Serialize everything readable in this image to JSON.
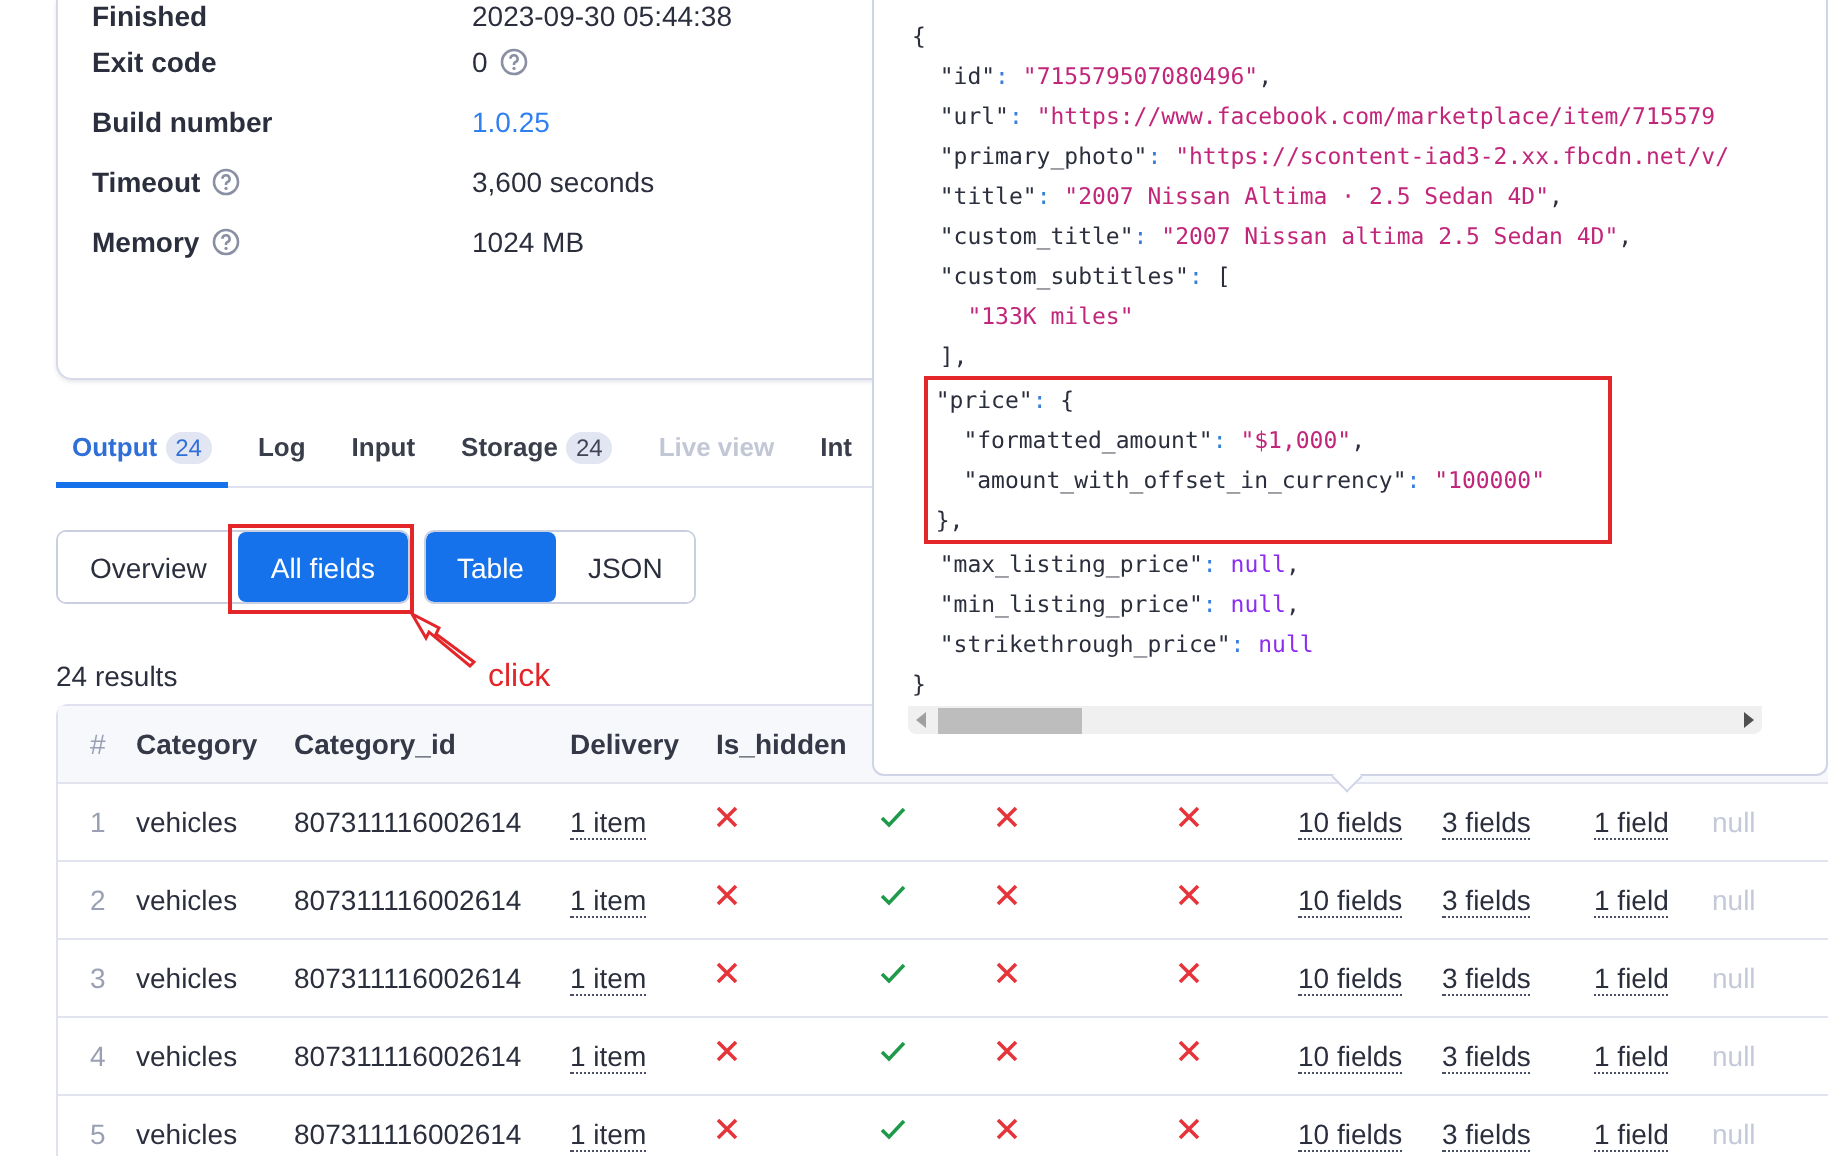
{
  "details": [
    {
      "label": "Finished",
      "value": "2023-09-30 05:44:38",
      "kind": "text",
      "label_help": false,
      "value_help": false
    },
    {
      "label": "Exit code",
      "value": "0",
      "kind": "text",
      "label_help": false,
      "value_help": true
    },
    {
      "label": "Build number",
      "value": "1.0.25",
      "kind": "link",
      "label_help": false,
      "value_help": false
    },
    {
      "label": "Timeout",
      "value": "3,600 seconds",
      "kind": "text",
      "label_help": true,
      "value_help": false
    },
    {
      "label": "Memory",
      "value": "1024 MB",
      "kind": "text",
      "label_help": true,
      "value_help": false
    }
  ],
  "tabs": [
    {
      "label": "Output",
      "badge": "24",
      "selected": true,
      "disabled": false
    },
    {
      "label": "Log",
      "selected": false,
      "disabled": false
    },
    {
      "label": "Input",
      "selected": false,
      "disabled": false
    },
    {
      "label": "Storage",
      "badge": "24",
      "selected": false,
      "disabled": false
    },
    {
      "label": "Live view",
      "selected": false,
      "disabled": true
    },
    {
      "label": "Int",
      "selected": false,
      "disabled": false
    }
  ],
  "view_modes": [
    {
      "label": "Overview",
      "selected": false
    },
    {
      "label": "All fields",
      "selected": true
    }
  ],
  "formats": [
    {
      "label": "Table",
      "selected": true
    },
    {
      "label": "JSON",
      "selected": false
    }
  ],
  "annotation": {
    "text": "click"
  },
  "results": "24 results",
  "table": {
    "columns": [
      "#",
      "Category",
      "Category_id",
      "Delivery",
      "Is_hidden"
    ],
    "rows": [
      {
        "cells": [
          {
            "kind": "index",
            "text": "1"
          },
          {
            "kind": "text",
            "text": "vehicles"
          },
          {
            "kind": "text",
            "text": "807311116002614"
          },
          {
            "kind": "link",
            "text": "1 item"
          },
          {
            "kind": "bool",
            "value": false
          },
          {
            "kind": "bool",
            "value": true
          },
          {
            "kind": "bool",
            "value": false
          },
          {
            "kind": "bool",
            "value": false
          },
          {
            "kind": "link",
            "text": "10 fields"
          },
          {
            "kind": "link",
            "text": "3 fields"
          },
          {
            "kind": "link",
            "text": "1 field"
          },
          {
            "kind": "null",
            "text": "null"
          }
        ]
      },
      {
        "cells": [
          {
            "kind": "index",
            "text": "2"
          },
          {
            "kind": "text",
            "text": "vehicles"
          },
          {
            "kind": "text",
            "text": "807311116002614"
          },
          {
            "kind": "link",
            "text": "1 item"
          },
          {
            "kind": "bool",
            "value": false
          },
          {
            "kind": "bool",
            "value": true
          },
          {
            "kind": "bool",
            "value": false
          },
          {
            "kind": "bool",
            "value": false
          },
          {
            "kind": "link",
            "text": "10 fields"
          },
          {
            "kind": "link",
            "text": "3 fields"
          },
          {
            "kind": "link",
            "text": "1 field"
          },
          {
            "kind": "null",
            "text": "null"
          }
        ]
      },
      {
        "cells": [
          {
            "kind": "index",
            "text": "3"
          },
          {
            "kind": "text",
            "text": "vehicles"
          },
          {
            "kind": "text",
            "text": "807311116002614"
          },
          {
            "kind": "link",
            "text": "1 item"
          },
          {
            "kind": "bool",
            "value": false
          },
          {
            "kind": "bool",
            "value": true
          },
          {
            "kind": "bool",
            "value": false
          },
          {
            "kind": "bool",
            "value": false
          },
          {
            "kind": "link",
            "text": "10 fields"
          },
          {
            "kind": "link",
            "text": "3 fields"
          },
          {
            "kind": "link",
            "text": "1 field"
          },
          {
            "kind": "null",
            "text": "null"
          }
        ]
      },
      {
        "cells": [
          {
            "kind": "index",
            "text": "4"
          },
          {
            "kind": "text",
            "text": "vehicles"
          },
          {
            "kind": "text",
            "text": "807311116002614"
          },
          {
            "kind": "link",
            "text": "1 item"
          },
          {
            "kind": "bool",
            "value": false
          },
          {
            "kind": "bool",
            "value": true
          },
          {
            "kind": "bool",
            "value": false
          },
          {
            "kind": "bool",
            "value": false
          },
          {
            "kind": "link",
            "text": "10 fields"
          },
          {
            "kind": "link",
            "text": "3 fields"
          },
          {
            "kind": "link",
            "text": "1 field"
          },
          {
            "kind": "null",
            "text": "null"
          }
        ]
      },
      {
        "cells": [
          {
            "kind": "index",
            "text": "5"
          },
          {
            "kind": "text",
            "text": "vehicles"
          },
          {
            "kind": "text",
            "text": "807311116002614"
          },
          {
            "kind": "link",
            "text": "1 item"
          },
          {
            "kind": "bool",
            "value": false
          },
          {
            "kind": "bool",
            "value": true
          },
          {
            "kind": "bool",
            "value": false
          },
          {
            "kind": "bool",
            "value": false
          },
          {
            "kind": "link",
            "text": "10 fields"
          },
          {
            "kind": "link",
            "text": "3 fields"
          },
          {
            "kind": "link",
            "text": "1 field"
          },
          {
            "kind": "null",
            "text": "null"
          }
        ]
      }
    ]
  },
  "popover": {
    "blocks": [
      {
        "highlighted": false,
        "lines": [
          {
            "tokens": [
              {
                "kind": "punct",
                "text": "{"
              }
            ]
          },
          {
            "tokens": [
              {
                "kind": "key",
                "text": "  \"id\""
              },
              {
                "kind": "colon",
                "text": ": "
              },
              {
                "kind": "string",
                "text": "\"715579507080496\""
              },
              {
                "kind": "punct",
                "text": ","
              }
            ]
          },
          {
            "tokens": [
              {
                "kind": "key",
                "text": "  \"url\""
              },
              {
                "kind": "colon",
                "text": ": "
              },
              {
                "kind": "string",
                "text": "\"https://www.facebook.com/marketplace/item/715579"
              }
            ]
          },
          {
            "tokens": [
              {
                "kind": "key",
                "text": "  \"primary_photo\""
              },
              {
                "kind": "colon",
                "text": ": "
              },
              {
                "kind": "string",
                "text": "\"https://scontent-iad3-2.xx.fbcdn.net/v/"
              }
            ]
          },
          {
            "tokens": [
              {
                "kind": "key",
                "text": "  \"title\""
              },
              {
                "kind": "colon",
                "text": ": "
              },
              {
                "kind": "string",
                "text": "\"2007 Nissan Altima · 2.5 Sedan 4D\""
              },
              {
                "kind": "punct",
                "text": ","
              }
            ]
          },
          {
            "tokens": [
              {
                "kind": "key",
                "text": "  \"custom_title\""
              },
              {
                "kind": "colon",
                "text": ": "
              },
              {
                "kind": "string",
                "text": "\"2007 Nissan altima 2.5 Sedan 4D\""
              },
              {
                "kind": "punct",
                "text": ","
              }
            ]
          },
          {
            "tokens": [
              {
                "kind": "key",
                "text": "  \"custom_subtitles\""
              },
              {
                "kind": "colon",
                "text": ": "
              },
              {
                "kind": "punct",
                "text": "["
              }
            ]
          },
          {
            "tokens": [
              {
                "kind": "string",
                "text": "    \"133K miles\""
              }
            ]
          },
          {
            "tokens": [
              {
                "kind": "punct",
                "text": "  ],"
              }
            ]
          }
        ]
      },
      {
        "highlighted": true,
        "lines": [
          {
            "tokens": [
              {
                "kind": "key",
                "text": "  \"price\""
              },
              {
                "kind": "colon",
                "text": ": "
              },
              {
                "kind": "punct",
                "text": "{"
              }
            ]
          },
          {
            "tokens": [
              {
                "kind": "key",
                "text": "    \"formatted_amount\""
              },
              {
                "kind": "colon",
                "text": ": "
              },
              {
                "kind": "string",
                "text": "\"$1,000\""
              },
              {
                "kind": "punct",
                "text": ","
              }
            ]
          },
          {
            "tokens": [
              {
                "kind": "key",
                "text": "    \"amount_with_offset_in_currency\""
              },
              {
                "kind": "colon",
                "text": ": "
              },
              {
                "kind": "string",
                "text": "\"100000\""
              }
            ]
          },
          {
            "tokens": [
              {
                "kind": "punct",
                "text": "  },"
              }
            ]
          }
        ]
      },
      {
        "highlighted": false,
        "lines": [
          {
            "tokens": [
              {
                "kind": "key",
                "text": "  \"max_listing_price\""
              },
              {
                "kind": "colon",
                "text": ": "
              },
              {
                "kind": "null",
                "text": "null"
              },
              {
                "kind": "punct",
                "text": ","
              }
            ]
          },
          {
            "tokens": [
              {
                "kind": "key",
                "text": "  \"min_listing_price\""
              },
              {
                "kind": "colon",
                "text": ": "
              },
              {
                "kind": "null",
                "text": "null"
              },
              {
                "kind": "punct",
                "text": ","
              }
            ]
          },
          {
            "tokens": [
              {
                "kind": "key",
                "text": "  \"strikethrough_price\""
              },
              {
                "kind": "colon",
                "text": ": "
              },
              {
                "kind": "null",
                "text": "null"
              }
            ]
          },
          {
            "tokens": [
              {
                "kind": "punct",
                "text": "}"
              }
            ]
          }
        ]
      }
    ]
  }
}
